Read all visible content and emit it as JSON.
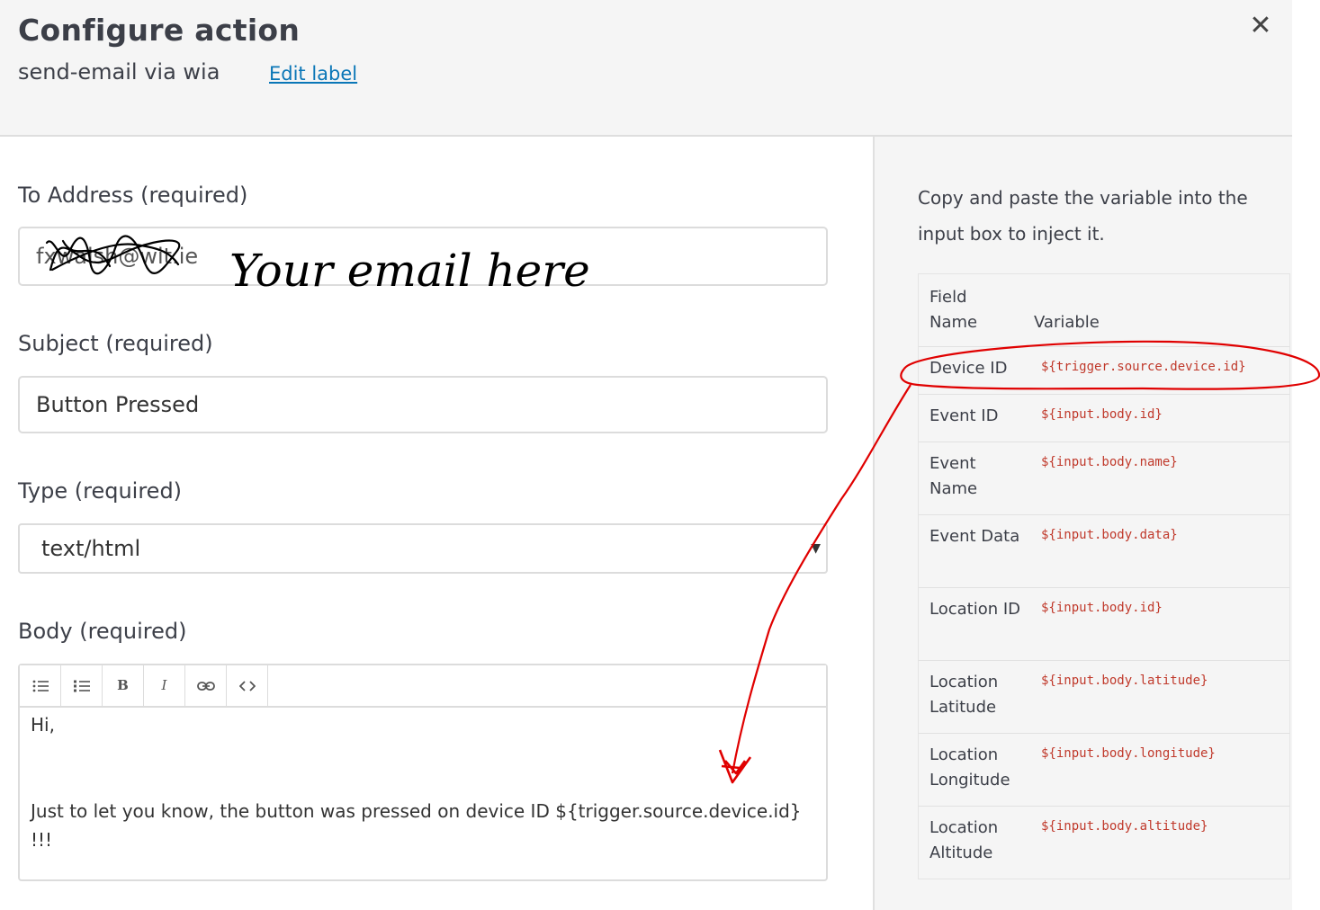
{
  "header": {
    "title": "Configure action",
    "subtitle": "send-email via wia",
    "edit_label": "Edit label",
    "close_symbol": "✕"
  },
  "form": {
    "to_label": "To Address (required)",
    "to_value": "fxwalsh@wit.ie",
    "annotation_text": "Your email here",
    "subject_label": "Subject (required)",
    "subject_value": "Button Pressed",
    "type_label": "Type (required)",
    "type_value": "text/html",
    "body_label": "Body (required)",
    "toolbar": [
      {
        "icon": "bullet-list-icon",
        "glyph": "☰"
      },
      {
        "icon": "numbered-list-icon",
        "glyph": "≡"
      },
      {
        "icon": "bold-icon",
        "glyph": "B"
      },
      {
        "icon": "italic-icon",
        "glyph": "I"
      },
      {
        "icon": "link-icon",
        "glyph": "⊂⊃"
      },
      {
        "icon": "code-icon",
        "glyph": "<>"
      }
    ],
    "body_line1": "Hi,",
    "body_line2": "Just to let you know, the button was pressed on device ID ${trigger.source.device.id}",
    "body_line3": "!!!"
  },
  "sidebar": {
    "hint": "Copy and paste the variable into the input box to inject it.",
    "col_field": "Field Name",
    "col_variable": "Variable",
    "rows": [
      {
        "field": "Device ID",
        "variable": "${trigger.source.device.id}"
      },
      {
        "field": "Event ID",
        "variable": "${input.body.id}"
      },
      {
        "field": "Event Name",
        "variable": "${input.body.name}"
      },
      {
        "field": "Event Data",
        "variable": "${input.body.data}"
      },
      {
        "field": "Location ID",
        "variable": "${input.body.id}"
      },
      {
        "field": "Location Latitude",
        "variable": "${input.body.latitude}"
      },
      {
        "field": "Location Longitude",
        "variable": "${input.body.longitude}"
      },
      {
        "field": "Location Altitude",
        "variable": "${input.body.altitude}"
      }
    ]
  },
  "colors": {
    "link": "#0a76b7",
    "variable": "#c0392b",
    "annotation_red": "#e00000"
  }
}
